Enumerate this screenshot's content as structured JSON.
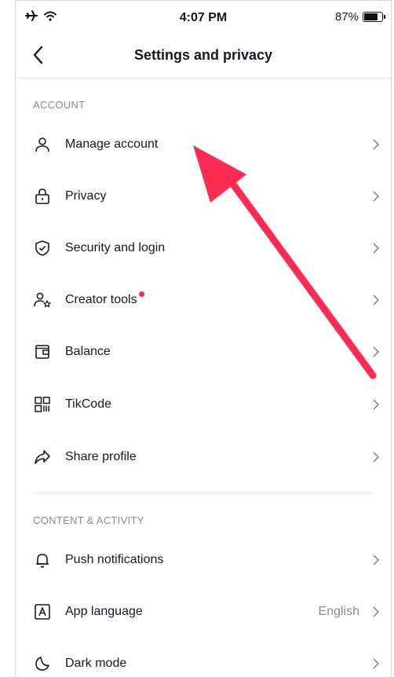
{
  "status_bar": {
    "time": "4:07 PM",
    "battery_percent": "87%",
    "battery_level": 0.87,
    "airplane_icon": "airplane-icon",
    "wifi_icon": "wifi-icon"
  },
  "header": {
    "title": "Settings and privacy",
    "back_icon": "chevron-left-icon"
  },
  "sections": [
    {
      "title": "ACCOUNT",
      "items": [
        {
          "label": "Manage account",
          "icon": "person-icon"
        },
        {
          "label": "Privacy",
          "icon": "lock-icon"
        },
        {
          "label": "Security and login",
          "icon": "shield-check-icon"
        },
        {
          "label": "Creator tools",
          "icon": "person-star-icon",
          "badge": "red-dot"
        },
        {
          "label": "Balance",
          "icon": "wallet-icon"
        },
        {
          "label": "TikCode",
          "icon": "qr-code-icon"
        },
        {
          "label": "Share profile",
          "icon": "share-icon"
        }
      ]
    },
    {
      "title": "CONTENT & ACTIVITY",
      "items": [
        {
          "label": "Push notifications",
          "icon": "bell-icon"
        },
        {
          "label": "App language",
          "icon": "language-icon",
          "value": "English"
        },
        {
          "label": "Dark mode",
          "icon": "moon-icon"
        }
      ]
    }
  ],
  "colors": {
    "accent_arrow": "#fe2c55",
    "text_primary": "#161823",
    "text_secondary": "#8a8b91",
    "badge": "#fe2c55"
  },
  "annotation": {
    "type": "arrow",
    "points_to": "Manage account"
  }
}
